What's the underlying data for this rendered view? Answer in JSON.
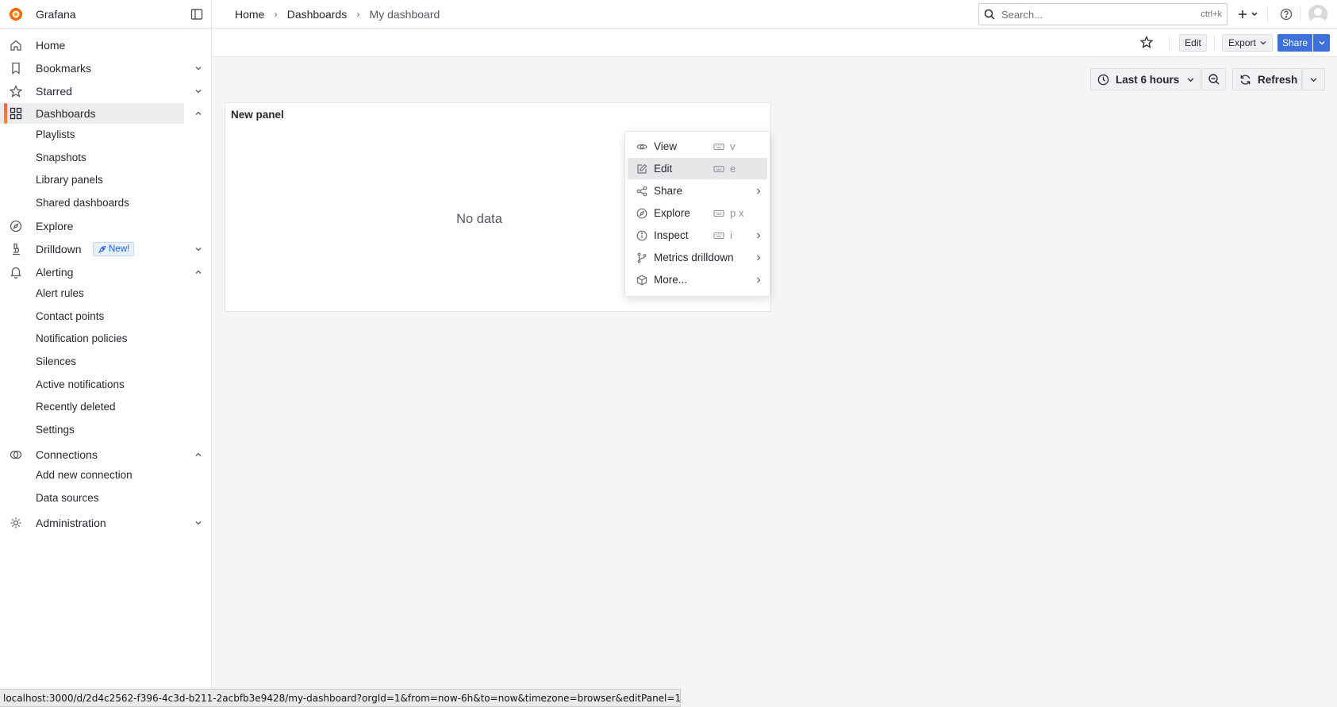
{
  "app": {
    "title": "Grafana"
  },
  "breadcrumbs": [
    "Home",
    "Dashboards",
    "My dashboard"
  ],
  "search": {
    "placeholder": "Search...",
    "shortcut": "ctrl+k"
  },
  "toolbar": {
    "edit": "Edit",
    "export": "Export",
    "share": "Share"
  },
  "sidebar": {
    "items": [
      {
        "label": "Home",
        "icon": "home-icon"
      },
      {
        "label": "Bookmarks",
        "icon": "bookmark-icon"
      },
      {
        "label": "Starred",
        "icon": "star-icon"
      },
      {
        "label": "Dashboards",
        "icon": "apps-icon"
      },
      {
        "label": "Explore",
        "icon": "compass-icon"
      },
      {
        "label": "Drilldown",
        "icon": "microscope-icon"
      },
      {
        "label": "Alerting",
        "icon": "bell-icon"
      },
      {
        "label": "Connections",
        "icon": "connections-icon"
      },
      {
        "label": "Administration",
        "icon": "cog-icon"
      }
    ],
    "dashboards_children": [
      "Playlists",
      "Snapshots",
      "Library panels",
      "Shared dashboards"
    ],
    "drilldown_badge": "New!",
    "alerting_children": [
      "Alert rules",
      "Contact points",
      "Notification policies",
      "Silences",
      "Active notifications",
      "Recently deleted",
      "Settings"
    ],
    "connections_children": [
      "Add new connection",
      "Data sources"
    ]
  },
  "time": {
    "range": "Last 6 hours",
    "refresh": "Refresh"
  },
  "panel": {
    "title": "New panel",
    "empty": "No data"
  },
  "menu": {
    "items": [
      {
        "label": "View",
        "shortcut": "v",
        "icon": "eye-icon"
      },
      {
        "label": "Edit",
        "shortcut": "e",
        "icon": "edit-icon"
      },
      {
        "label": "Share",
        "shortcut": "",
        "icon": "share-icon"
      },
      {
        "label": "Explore",
        "shortcut": "p x",
        "icon": "compass-icon"
      },
      {
        "label": "Inspect",
        "shortcut": "i",
        "icon": "info-icon"
      },
      {
        "label": "Metrics drilldown",
        "shortcut": "",
        "icon": "code-branch-icon"
      },
      {
        "label": "More...",
        "shortcut": "",
        "icon": "cube-icon"
      }
    ]
  },
  "status_url": "localhost:3000/d/2d4c2562-f396-4c3d-b211-2acbfb3e9428/my-dashboard?orgId=1&from=now-6h&to=now&timezone=browser&editPanel=1",
  "colors": {
    "primary": "#3d71d9",
    "accent": "#f55f3e",
    "badge": "#1f62e0"
  }
}
